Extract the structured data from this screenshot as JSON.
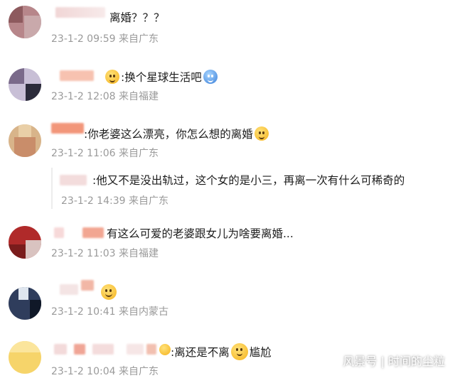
{
  "comments": [
    {
      "text": "离婚？？？",
      "meta": "23-1-2 09:59 来自广东"
    },
    {
      "text": ":换个星球生活吧",
      "meta": "23-1-2 12:08 来自福建"
    },
    {
      "text": ":你老婆这么漂亮，你怎么想的离婚",
      "meta": "23-1-2 11:06 来自广东"
    },
    {
      "text": ":他又不是没出轨过，这个女的是小三，再离一次有什么可稀奇的",
      "meta": "23-1-2 14:39 来自广东"
    },
    {
      "text": "有这么可爱的老婆跟女儿为啥要离婚...",
      "meta": "23-1-2 11:03 来自福建"
    },
    {
      "text": "",
      "meta": "23-1-2 10:41 来自内蒙古"
    },
    {
      "text": ":离还是不离",
      "text2": "尴尬",
      "meta": "23-1-2 10:04 来自广东"
    }
  ],
  "watermark": "风景号 | 时间的尘粒",
  "emoji_names": [
    "crown-emoji-icon",
    "blue-bird-emoji-icon",
    "hug-emoji-icon",
    "laugh-cry-emoji-icon",
    "think-emoji-icon"
  ]
}
